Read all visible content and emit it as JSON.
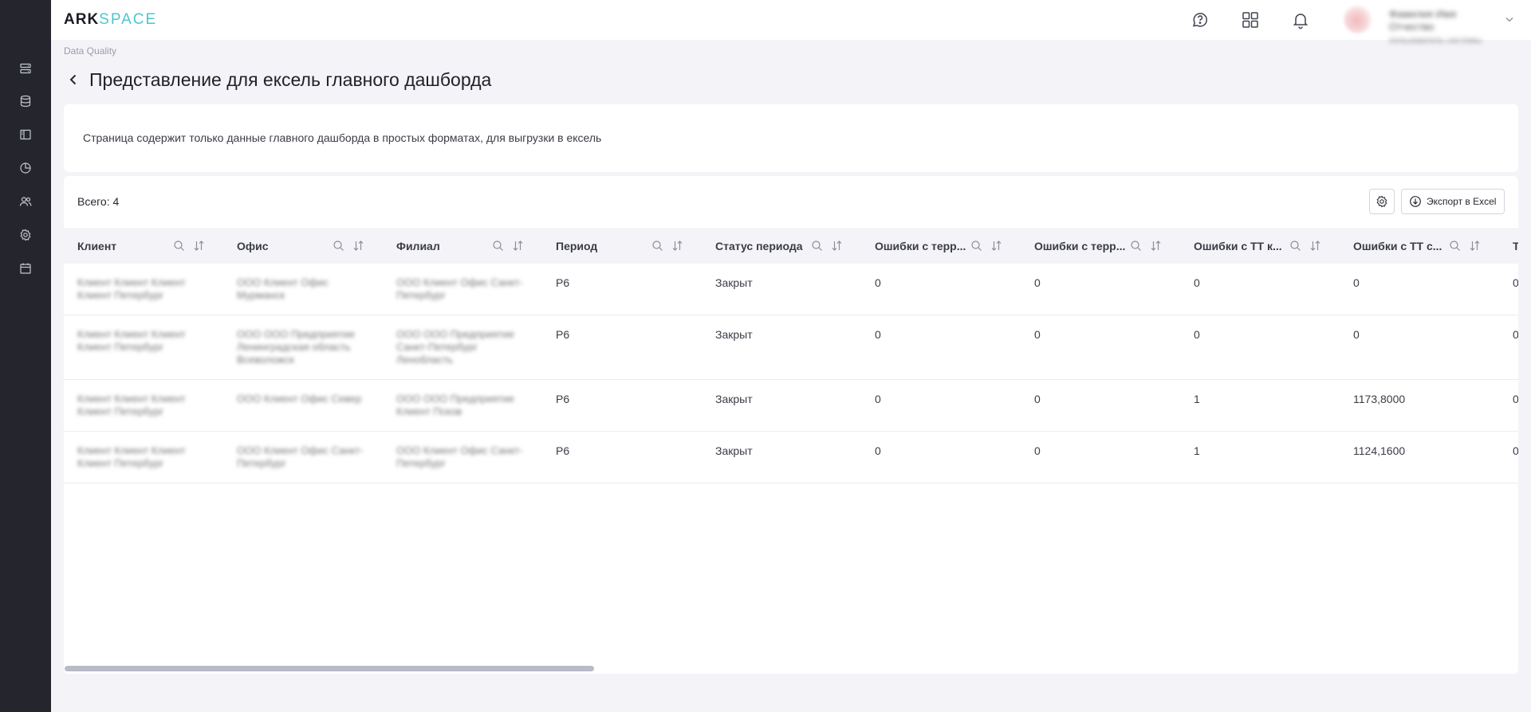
{
  "logo": {
    "part1": "ARK",
    "part2": "SPACE"
  },
  "sidebar": {
    "items": [
      {
        "name": "sidebar-item-dashboards",
        "icon": "list-rows-icon"
      },
      {
        "name": "sidebar-item-database",
        "icon": "database-icon"
      },
      {
        "name": "sidebar-item-panel",
        "icon": "panel-icon"
      },
      {
        "name": "sidebar-item-analytics",
        "icon": "pie-icon"
      },
      {
        "name": "sidebar-item-users",
        "icon": "users-icon"
      },
      {
        "name": "sidebar-item-settings",
        "icon": "gear-icon"
      },
      {
        "name": "sidebar-item-calendar",
        "icon": "calendar-icon"
      }
    ]
  },
  "header": {
    "icons": [
      "chat-question-icon",
      "apps-grid-icon",
      "bell-icon"
    ],
    "user": {
      "name": "Фамилия Имя Отчество",
      "role": "пользователь системы"
    }
  },
  "breadcrumb": "Data Quality",
  "page_title": "Представление для ексель главного дашборда",
  "description": "Страница содержит только данные главного дашборда в простых форматах, для выгрузки в ексель",
  "table": {
    "total_label": "Всего: 4",
    "export_label": "Экспорт в Excel",
    "columns": [
      "Клиент",
      "Офис",
      "Филиал",
      "Период",
      "Статус периода",
      "Ошибки с терр...",
      "Ошибки с терр...",
      "Ошибки с ТТ к...",
      "Ошибки с ТТ с...",
      "Т"
    ],
    "rows": [
      {
        "client": "Клиент Клиент Клиент Клиент Петербург",
        "office": "ООО Клиент Офис Мурманск",
        "branch": "ООО Клиент Офис Санкт-Петербург",
        "period": "P6",
        "status": "Закрыт",
        "v1": "0",
        "v2": "0",
        "v3": "0",
        "v4": "0",
        "v5": "0"
      },
      {
        "client": "Клиент Клиент Клиент Клиент Петербург",
        "office": "ООО ООО Предприятие Ленинградская область Всеволожск",
        "branch": "ООО ООО Предприятие Санкт-Петербург Ленобласть",
        "period": "P6",
        "status": "Закрыт",
        "v1": "0",
        "v2": "0",
        "v3": "0",
        "v4": "0",
        "v5": "0"
      },
      {
        "client": "Клиент Клиент Клиент Клиент Петербург",
        "office": "ООО Клиент Офис Север",
        "branch": "ООО ООО Предприятие Клиент Псков",
        "period": "P6",
        "status": "Закрыт",
        "v1": "0",
        "v2": "0",
        "v3": "1",
        "v4": "1173,8000",
        "v5": "0"
      },
      {
        "client": "Клиент Клиент Клиент Клиент Петербург",
        "office": "ООО Клиент Офис Санкт-Петербург",
        "branch": "ООО Клиент Офис Санкт-Петербург",
        "period": "P6",
        "status": "Закрыт",
        "v1": "0",
        "v2": "0",
        "v3": "1",
        "v4": "1124,1600",
        "v5": "0"
      }
    ]
  }
}
